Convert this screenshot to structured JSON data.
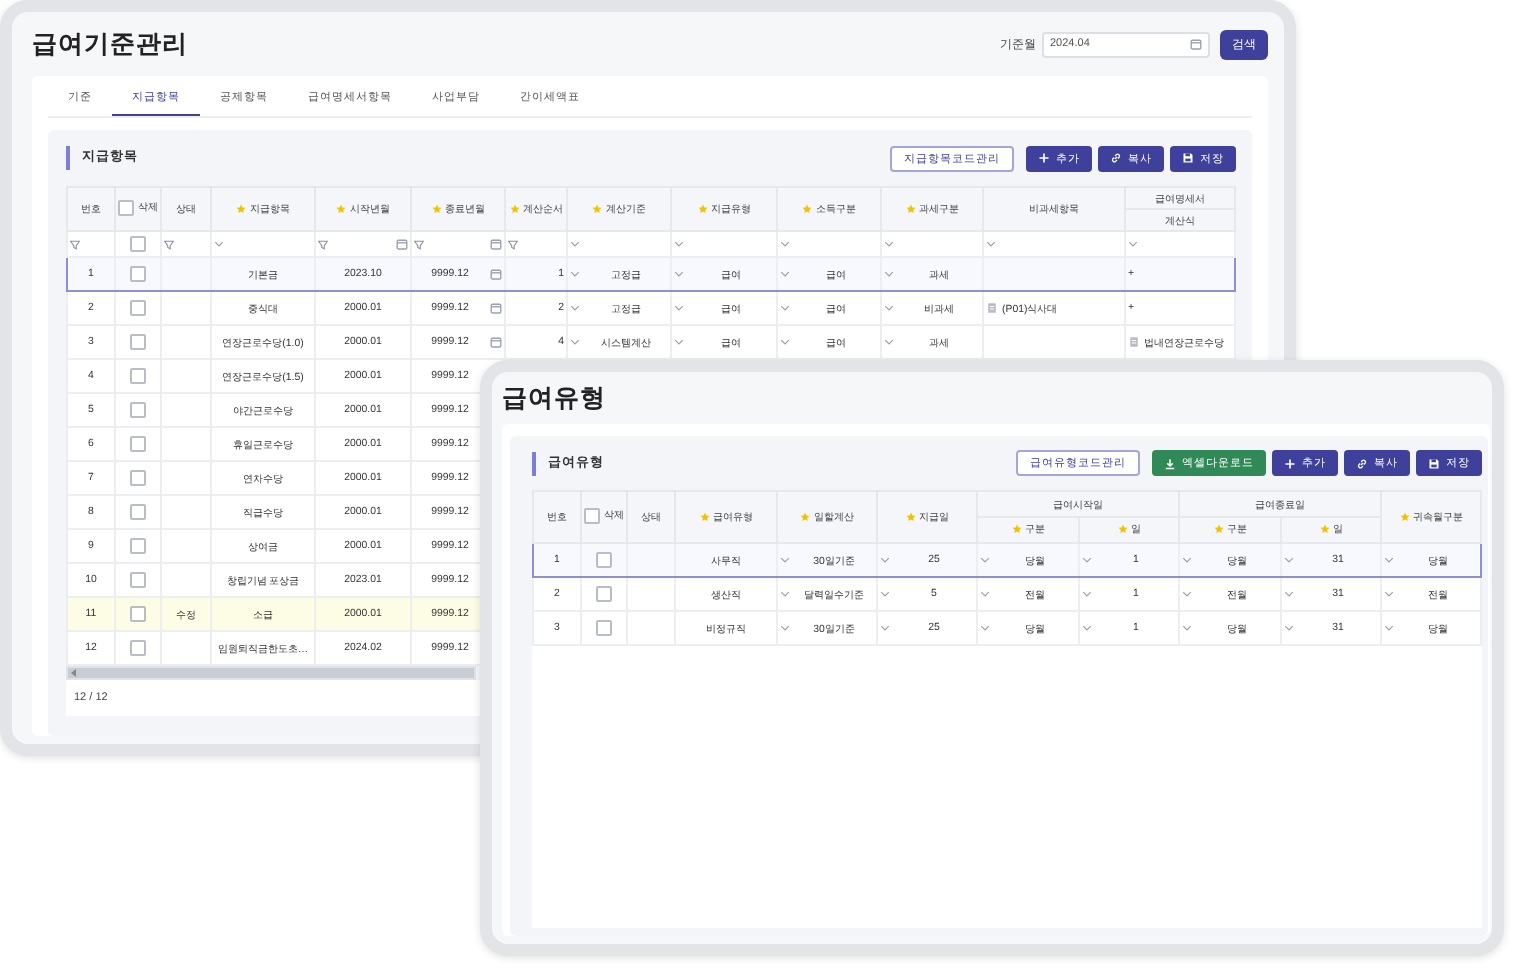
{
  "back_window": {
    "title": "급여기준관리",
    "month_label": "기준월",
    "month_value": "2024.04",
    "search_button": "검색",
    "tabs": [
      {
        "label": "기준",
        "selected": false
      },
      {
        "label": "지급항목",
        "selected": true
      },
      {
        "label": "공제항목",
        "selected": false
      },
      {
        "label": "급여명세서항목",
        "selected": false
      },
      {
        "label": "사업부담",
        "selected": false
      },
      {
        "label": "간이세액표",
        "selected": false
      }
    ],
    "section": {
      "title": "지급항목",
      "buttons": [
        {
          "label": "지급항목코드관리",
          "kind": "outline"
        },
        {
          "label": "추가",
          "kind": "add"
        },
        {
          "label": "복사",
          "kind": "copy"
        },
        {
          "label": "저장",
          "kind": "save"
        }
      ]
    },
    "table": {
      "columns": [
        {
          "label": "번호",
          "kind": "no"
        },
        {
          "label": "삭제",
          "kind": "check",
          "checked": false
        },
        {
          "label": "상태",
          "kind": "status"
        },
        {
          "label": "지급항목",
          "required": true,
          "kind": "text"
        },
        {
          "label": "시작년월",
          "required": true,
          "kind": "text"
        },
        {
          "label": "종료년월",
          "required": true,
          "kind": "date"
        },
        {
          "label": "계산순서",
          "required": true,
          "kind": "number"
        },
        {
          "label": "계산기준",
          "required": true,
          "kind": "select"
        },
        {
          "label": "지급유형",
          "required": true,
          "kind": "select"
        },
        {
          "label": "소득구분",
          "required": true,
          "kind": "select"
        },
        {
          "label": "과세구분",
          "required": true,
          "kind": "select"
        },
        {
          "label": "비과세항목",
          "kind": "left"
        },
        {
          "label": "급여명세서",
          "columns": [
            {
              "label": "계산식",
              "kind": "left"
            }
          ]
        }
      ],
      "filter_row": [
        {
          "kind": "funnel"
        },
        {
          "kind": "checkbox",
          "checked": false
        },
        {
          "kind": "funnel"
        },
        {
          "kind": "chevron"
        },
        {
          "kind": "datefilter"
        },
        {
          "kind": "datefilter"
        },
        {
          "kind": "funnel"
        },
        {
          "kind": "chevron"
        },
        {
          "kind": "chevron"
        },
        {
          "kind": "chevron"
        },
        {
          "kind": "chevron"
        },
        {
          "kind": "chevron"
        },
        {
          "kind": "chevron"
        }
      ],
      "rows": [
        {
          "selected": true,
          "edited": false,
          "cells": [
            "1",
            {
              "checked": false
            },
            "",
            "기본금",
            "2023.10",
            {
              "text": "9999.12",
              "calendar": true
            },
            "1",
            "고정급",
            "급여",
            "급여",
            "과세",
            "",
            "+"
          ]
        },
        {
          "selected": false,
          "edited": false,
          "cells": [
            "2",
            {
              "checked": false
            },
            "",
            "중식대",
            "2000.01",
            {
              "text": "9999.12",
              "calendar": true
            },
            "2",
            "고정급",
            "급여",
            "급여",
            "비과세",
            {
              "text": "(P01)식사대",
              "tagged": true
            },
            "+"
          ]
        },
        {
          "selected": false,
          "edited": false,
          "cells": [
            "3",
            {
              "checked": false
            },
            "",
            "연장근로수당(1.0)",
            "2000.01",
            {
              "text": "9999.12",
              "calendar": true
            },
            "4",
            "시스템계산",
            "급여",
            "급여",
            "과세",
            "",
            {
              "text": "법내연장근로수당",
              "tagged": true
            }
          ]
        },
        {
          "selected": false,
          "edited": false,
          "cells": [
            "4",
            {
              "checked": false
            },
            "",
            "연장근로수당(1.5)",
            "2000.01",
            "9999.12"
          ]
        },
        {
          "selected": false,
          "edited": false,
          "cells": [
            "5",
            {
              "checked": false
            },
            "",
            "야간근로수당",
            "2000.01",
            "9999.12"
          ]
        },
        {
          "selected": false,
          "edited": false,
          "cells": [
            "6",
            {
              "checked": false
            },
            "",
            "휴일근로수당",
            "2000.01",
            "9999.12"
          ]
        },
        {
          "selected": false,
          "edited": false,
          "cells": [
            "7",
            {
              "checked": false
            },
            "",
            "연차수당",
            "2000.01",
            "9999.12"
          ]
        },
        {
          "selected": false,
          "edited": false,
          "cells": [
            "8",
            {
              "checked": false
            },
            "",
            "직급수당",
            "2000.01",
            "9999.12"
          ]
        },
        {
          "selected": false,
          "edited": false,
          "cells": [
            "9",
            {
              "checked": false
            },
            "",
            "상여금",
            "2000.01",
            "9999.12"
          ]
        },
        {
          "selected": false,
          "edited": false,
          "cells": [
            "10",
            {
              "checked": false
            },
            "",
            "창립기념 포상금",
            "2023.01",
            "9999.12"
          ]
        },
        {
          "selected": false,
          "edited": true,
          "cells": [
            "11",
            {
              "checked": false
            },
            "수정",
            "소급",
            "2000.01",
            "9999.12"
          ]
        },
        {
          "selected": false,
          "edited": false,
          "cells": [
            "12",
            {
              "checked": false
            },
            "",
            "임원퇴직금한도초…",
            "2024.02",
            "9999.12"
          ]
        }
      ],
      "footer": "12 / 12"
    }
  },
  "front_window": {
    "title": "급여유형",
    "section": {
      "title": "급여유형",
      "buttons": [
        {
          "label": "급여유형코드관리",
          "kind": "outline"
        },
        {
          "label": "엑셀다운로드",
          "kind": "excel"
        },
        {
          "label": "추가",
          "kind": "add"
        },
        {
          "label": "복사",
          "kind": "copy"
        },
        {
          "label": "저장",
          "kind": "save"
        }
      ]
    },
    "table": {
      "columns": [
        {
          "label": "번호",
          "kind": "no"
        },
        {
          "label": "삭제",
          "kind": "check",
          "checked": false
        },
        {
          "label": "상태",
          "kind": "status"
        },
        {
          "label": "급여유형",
          "required": true,
          "kind": "text"
        },
        {
          "label": "일할계산",
          "required": true,
          "kind": "select"
        },
        {
          "label": "지급일",
          "required": true,
          "kind": "select"
        },
        {
          "label": "급여시작일",
          "colspan": 2,
          "columns": [
            {
              "label": "구분",
              "required": true,
              "kind": "select"
            },
            {
              "label": "일",
              "required": true,
              "kind": "select"
            }
          ]
        },
        {
          "label": "급여종료일",
          "colspan": 2,
          "columns": [
            {
              "label": "구분",
              "required": true,
              "kind": "select"
            },
            {
              "label": "일",
              "required": true,
              "kind": "select"
            }
          ]
        },
        {
          "label": "귀속월구분",
          "required": true,
          "kind": "select"
        }
      ],
      "rows": [
        {
          "selected": true,
          "edited": false,
          "cells": [
            "1",
            {
              "checked": false
            },
            "",
            "사무직",
            "30일기준",
            "25",
            "당월",
            "1",
            "당월",
            "31",
            "당월"
          ]
        },
        {
          "selected": false,
          "edited": false,
          "cells": [
            "2",
            {
              "checked": false
            },
            "",
            "생산직",
            "달력일수기준",
            "5",
            "전월",
            "1",
            "전월",
            "31",
            "전월"
          ]
        },
        {
          "selected": false,
          "edited": false,
          "cells": [
            "3",
            {
              "checked": false
            },
            "",
            "비정규직",
            "30일기준",
            "25",
            "당월",
            "1",
            "당월",
            "31",
            "당월"
          ]
        }
      ]
    }
  }
}
